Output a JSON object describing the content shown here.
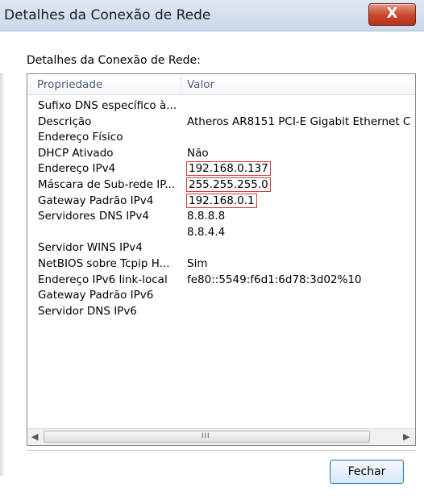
{
  "window": {
    "title": "Detalhes da Conexão de Rede",
    "close_glyph": "X"
  },
  "group_label": "Detalhes da Conexão de Rede:",
  "columns": {
    "property": "Propriedade",
    "value": "Valor"
  },
  "rows": [
    {
      "prop": "Sufixo DNS específico à...",
      "value": ""
    },
    {
      "prop": "Descrição",
      "value": "Atheros AR8151 PCI-E Gigabit Ethernet C"
    },
    {
      "prop": "Endereço Físico",
      "value": ""
    },
    {
      "prop": "DHCP Ativado",
      "value": "Não"
    },
    {
      "prop": "Endereço IPv4",
      "value": "192.168.0.137"
    },
    {
      "prop": "Máscara de Sub-rede IP...",
      "value": "255.255.255.0"
    },
    {
      "prop": "Gateway Padrão IPv4",
      "value": "192.168.0.1"
    },
    {
      "prop": "Servidores DNS IPv4",
      "value": "8.8.8.8"
    },
    {
      "prop": "",
      "value": "8.8.4.4"
    },
    {
      "prop": "Servidor WINS IPv4",
      "value": ""
    },
    {
      "prop": "NetBIOS sobre Tcpip H...",
      "value": "Sim"
    },
    {
      "prop": "Endereço IPv6 link-local",
      "value": "fe80::5549:f6d1:6d78:3d02%10"
    },
    {
      "prop": "Gateway Padrão IPv6",
      "value": ""
    },
    {
      "prop": "Servidor DNS IPv6",
      "value": ""
    }
  ],
  "scrollbar": {
    "left_arrow": "◀",
    "right_arrow": "▶",
    "grip": "III"
  },
  "buttons": {
    "close_label": "Fechar"
  },
  "colors": {
    "highlight_border": "#d83a3a",
    "close_button": "#c9452b",
    "default_button_border": "#3c7fb1"
  }
}
